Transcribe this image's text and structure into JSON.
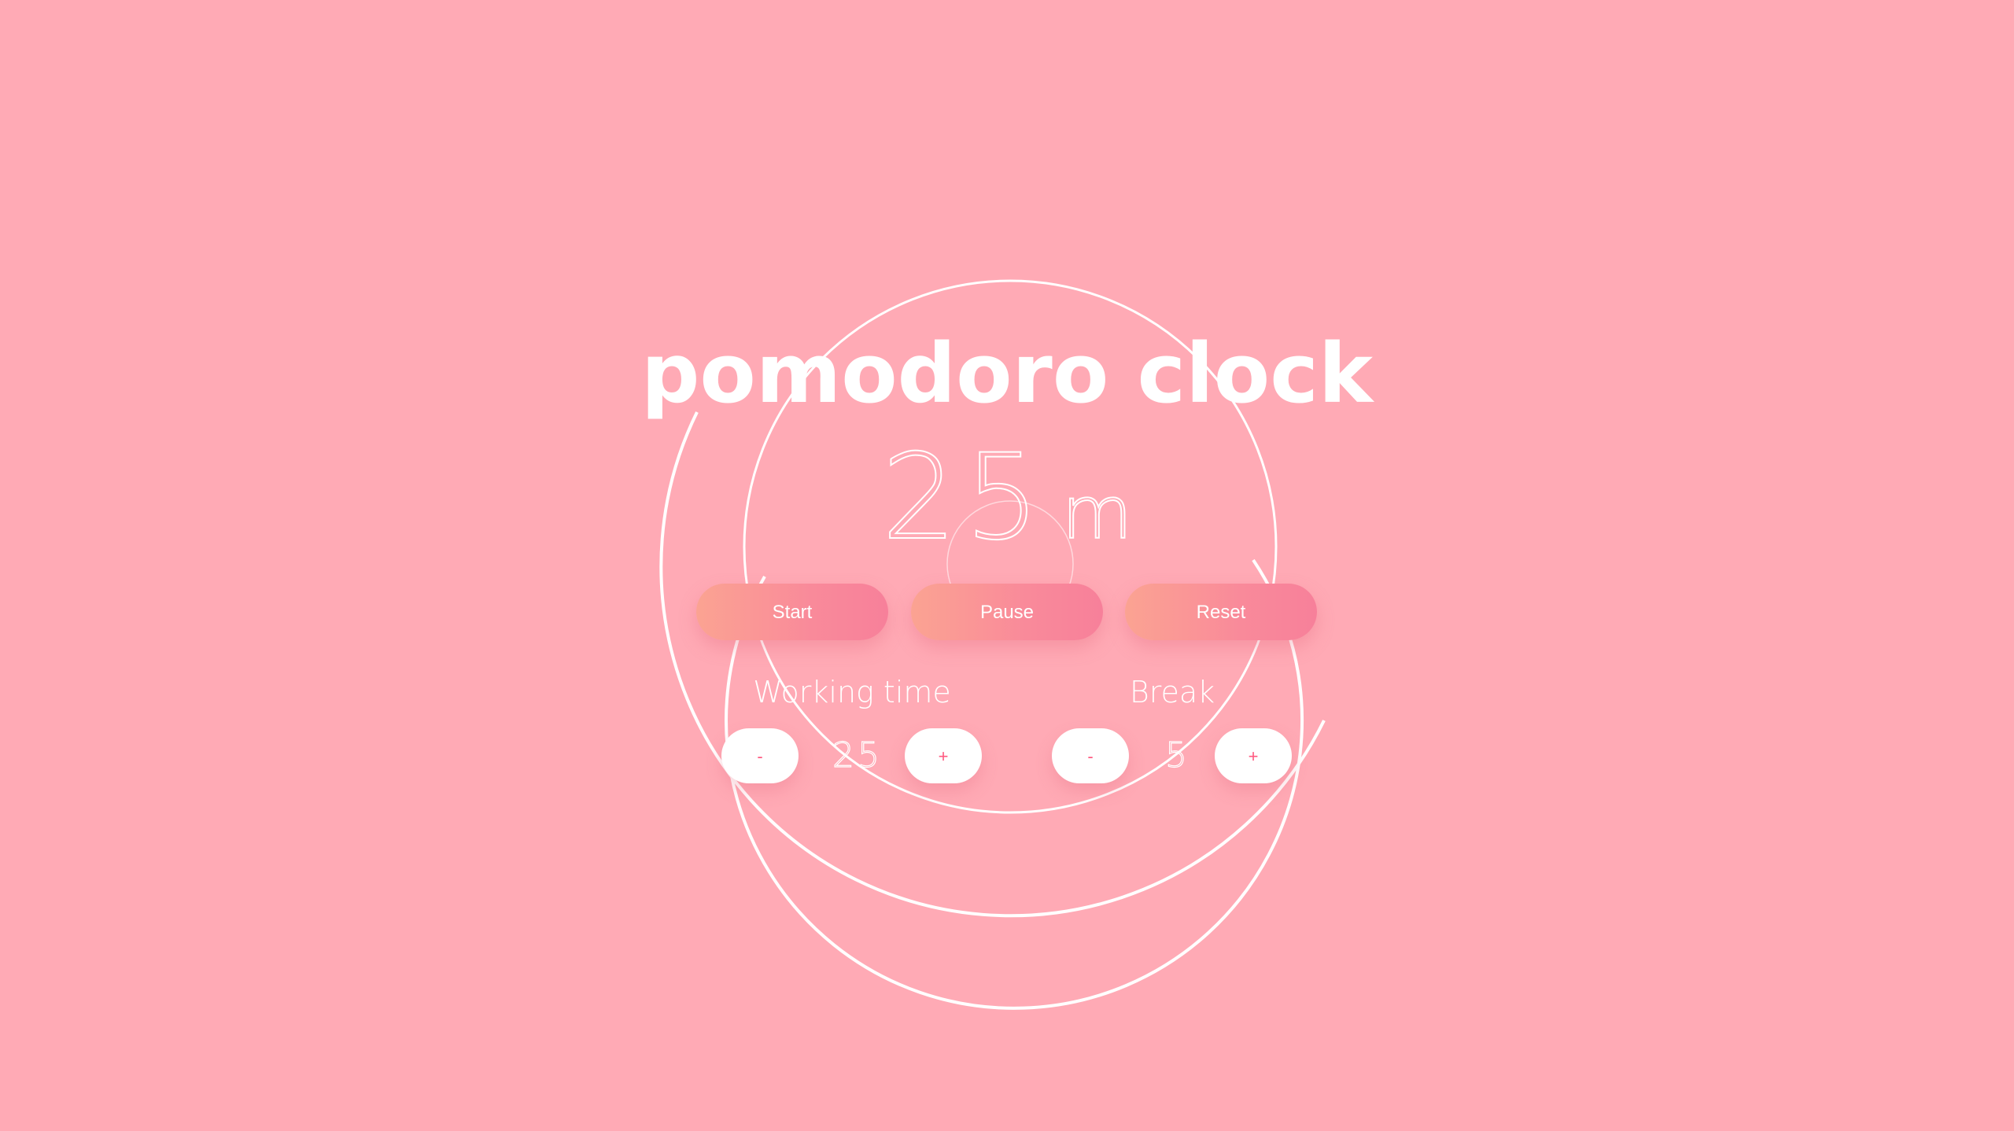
{
  "app": {
    "title": "pomodoro clock"
  },
  "timer": {
    "value": "25",
    "unit": "m"
  },
  "controls": {
    "start_label": "Start",
    "pause_label": "Pause",
    "reset_label": "Reset"
  },
  "working": {
    "label": "Working time",
    "minus_label": "-",
    "value": "25",
    "plus_label": "+"
  },
  "break": {
    "label": "Break",
    "minus_label": "-",
    "value": "5",
    "plus_label": "+"
  },
  "colors": {
    "background": "#ffaab5",
    "text": "#ffffff",
    "button_gradient_start": "#fba392",
    "button_gradient_end": "#f7809a",
    "stepper_text": "#ff5a80"
  }
}
